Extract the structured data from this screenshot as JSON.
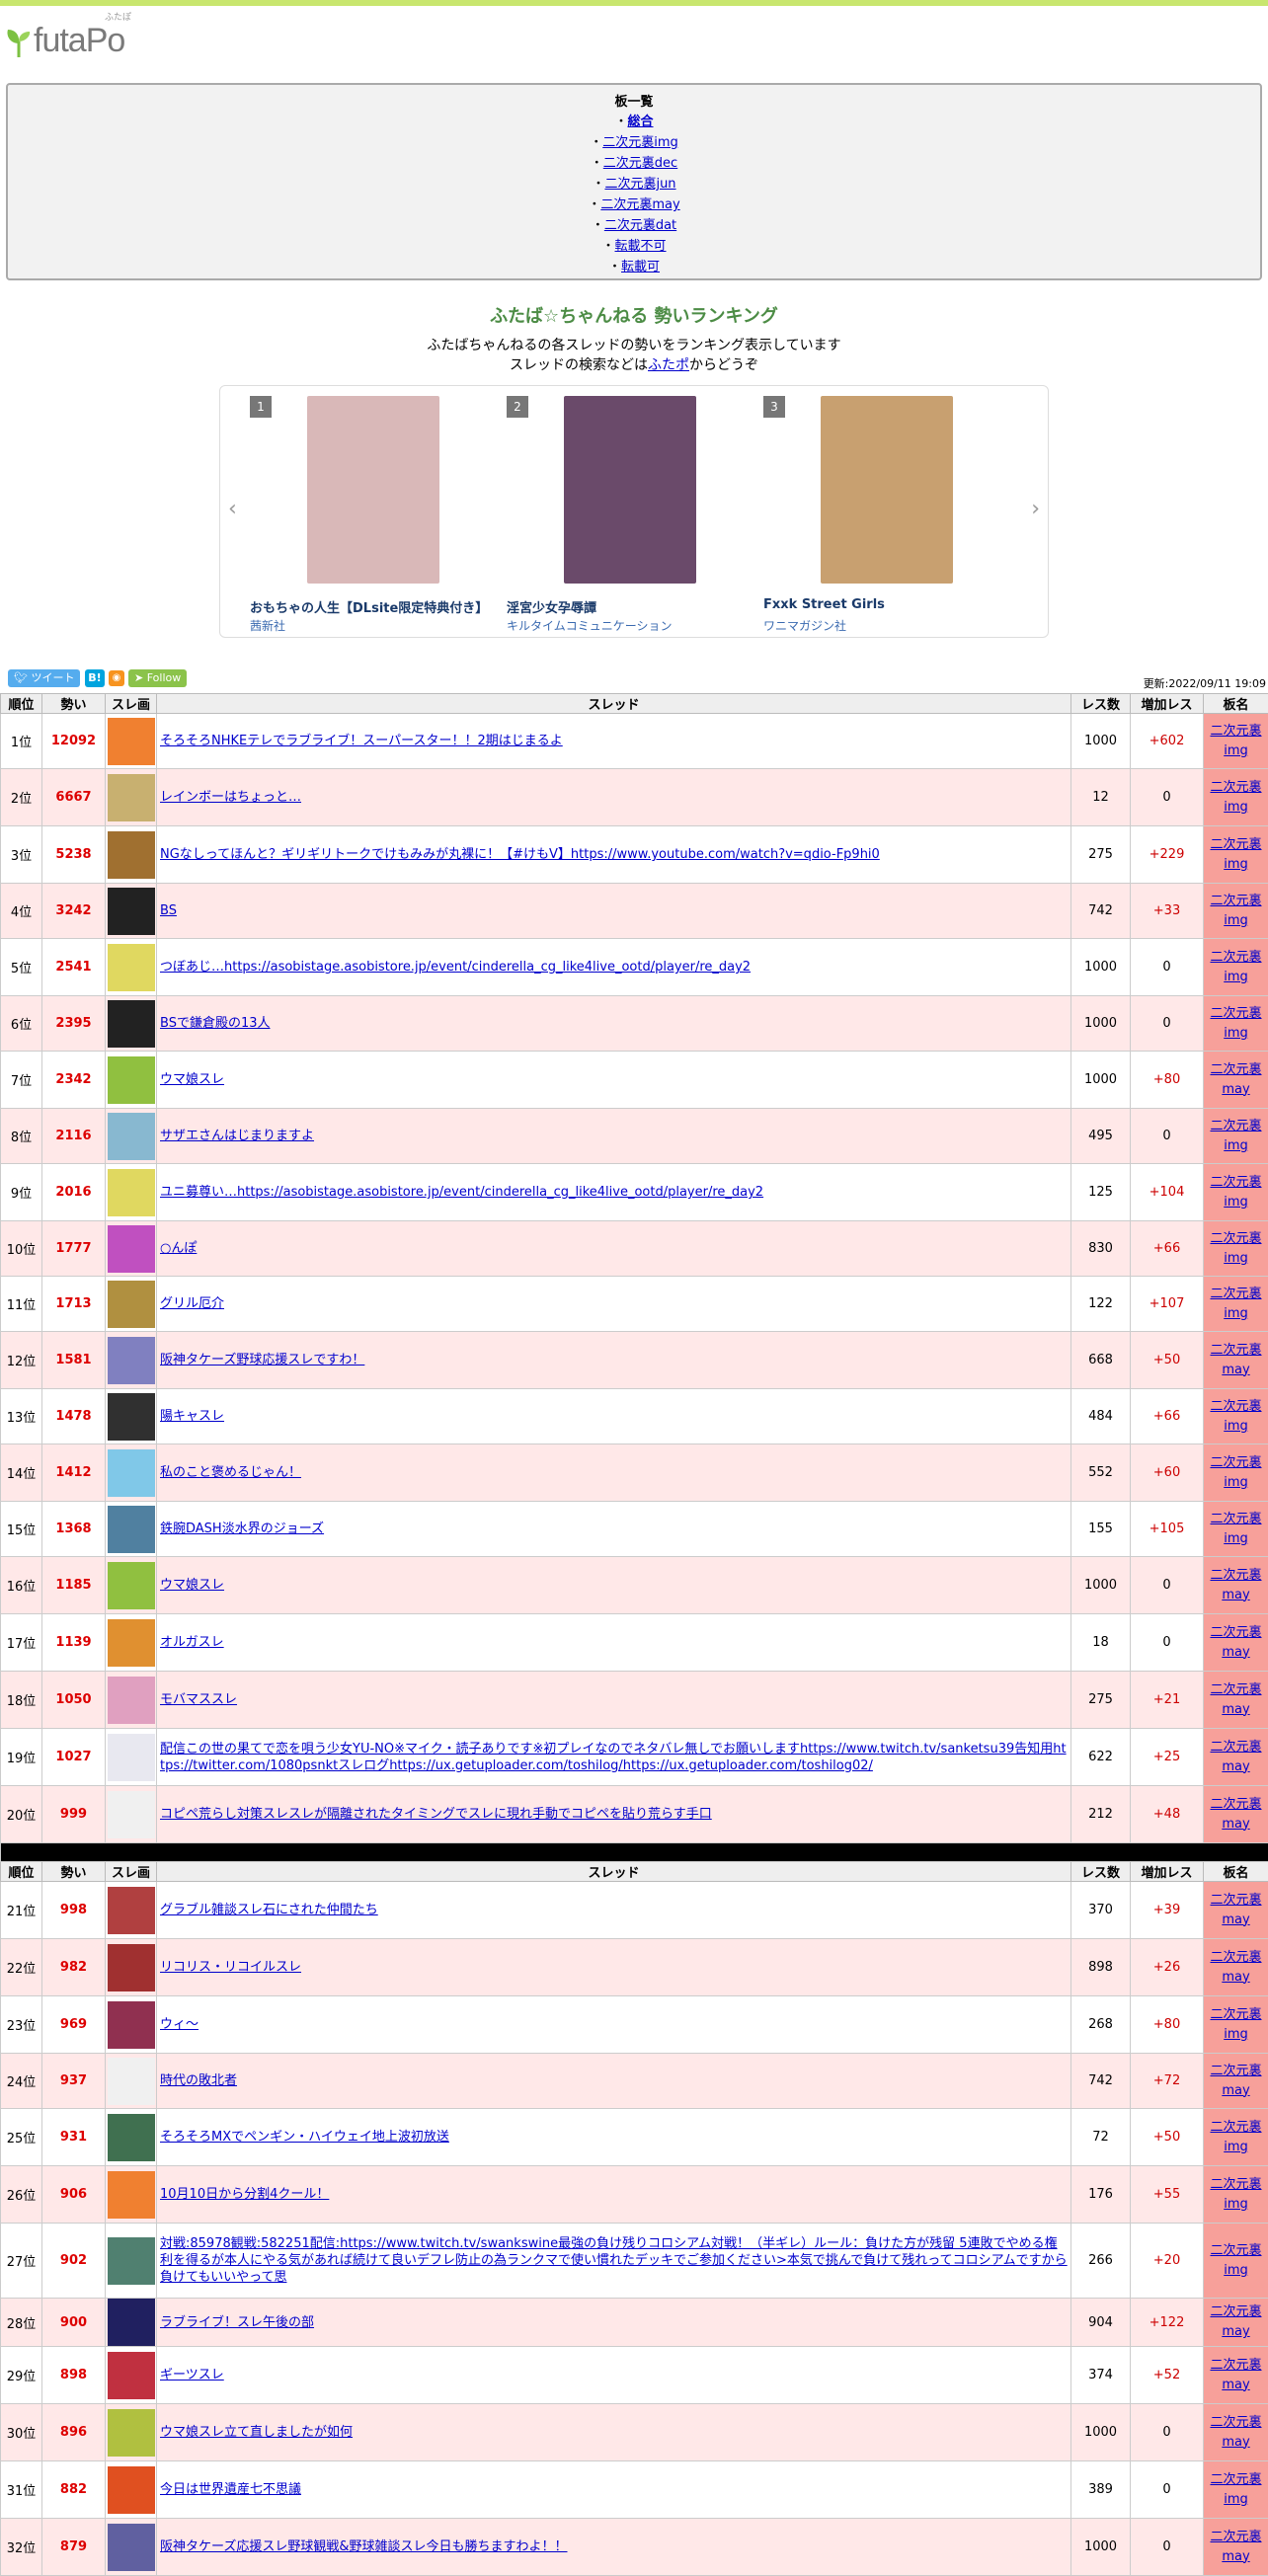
{
  "site": {
    "logo": "futaPo",
    "logo_ruby": "ふたぽ"
  },
  "boards": {
    "title": "板一覧",
    "items": [
      "総合",
      "二次元裏img",
      "二次元裏dec",
      "二次元裏jun",
      "二次元裏may",
      "二次元裏dat",
      "転載不可",
      "転載可"
    ]
  },
  "ranking": {
    "title": "ふたば☆ちゃんねる 勢いランキング",
    "desc1": "ふたばちゃんねるの各スレッドの勢いをランキング表示しています",
    "desc2_pre": "スレッドの検索などは",
    "desc2_link": "ふたポ",
    "desc2_post": "からどうぞ"
  },
  "carousel": [
    {
      "rank": "1",
      "title": "おもちゃの人生【DLsite限定特典付き】",
      "publisher": "茜新社",
      "color": "#d9b8b8"
    },
    {
      "rank": "2",
      "title": "淫宮少女孕辱譚",
      "publisher": "キルタイムコミュニケーション",
      "color": "#6a4a6a"
    },
    {
      "rank": "3",
      "title": "Fxxk Street Girls",
      "publisher": "ワニマガジン社",
      "color": "#c8a070"
    }
  ],
  "social": {
    "tweet": "ツイート",
    "hatena": "B!",
    "rss": "",
    "follow": "Follow"
  },
  "updated": "更新:2022/09/11 19:09",
  "columns": [
    "順位",
    "勢い",
    "スレ画",
    "スレッド",
    "レス数",
    "増加レス",
    "板名"
  ],
  "threads": [
    {
      "rank": "1位",
      "ikioi": "12092",
      "title": "そろそろNHKEテレでラブライブ！スーパースター！！2期はじまるよ",
      "res": "1000",
      "inc": "+602",
      "board1": "二次元裏",
      "board2": "img",
      "color": "#f08030"
    },
    {
      "rank": "2位",
      "ikioi": "6667",
      "title": "レインボーはちょっと…",
      "res": "12",
      "inc": "0",
      "board1": "二次元裏",
      "board2": "img",
      "color": "#c8b070"
    },
    {
      "rank": "3位",
      "ikioi": "5238",
      "title": "NGなしってほんと？ギリギリトークでけもみみが丸裸に！【#けもV】https://www.youtube.com/watch?v=qdio-Fp9hi0",
      "res": "275",
      "inc": "+229",
      "board1": "二次元裏",
      "board2": "img",
      "color": "#a07030"
    },
    {
      "rank": "4位",
      "ikioi": "3242",
      "title": "BS",
      "res": "742",
      "inc": "+33",
      "board1": "二次元裏",
      "board2": "img",
      "color": "#222222"
    },
    {
      "rank": "5位",
      "ikioi": "2541",
      "title": "つぼあじ…https://asobistage.asobistore.jp/event/cinderella_cg_like4live_ootd/player/re_day2",
      "res": "1000",
      "inc": "0",
      "board1": "二次元裏",
      "board2": "img",
      "color": "#e0d860"
    },
    {
      "rank": "6位",
      "ikioi": "2395",
      "title": "BSで鎌倉殿の13人",
      "res": "1000",
      "inc": "0",
      "board1": "二次元裏",
      "board2": "img",
      "color": "#222222"
    },
    {
      "rank": "7位",
      "ikioi": "2342",
      "title": "ウマ娘スレ",
      "res": "1000",
      "inc": "+80",
      "board1": "二次元裏",
      "board2": "may",
      "color": "#90c040"
    },
    {
      "rank": "8位",
      "ikioi": "2116",
      "title": "サザエさんはじまりますよ",
      "res": "495",
      "inc": "0",
      "board1": "二次元裏",
      "board2": "img",
      "color": "#88b8d0"
    },
    {
      "rank": "9位",
      "ikioi": "2016",
      "title": "ユニ募尊い…https://asobistage.asobistore.jp/event/cinderella_cg_like4live_ootd/player/re_day2",
      "res": "125",
      "inc": "+104",
      "board1": "二次元裏",
      "board2": "img",
      "color": "#e0d860"
    },
    {
      "rank": "10位",
      "ikioi": "1777",
      "title": "○んぽ",
      "res": "830",
      "inc": "+66",
      "board1": "二次元裏",
      "board2": "img",
      "color": "#c050c0"
    },
    {
      "rank": "11位",
      "ikioi": "1713",
      "title": "グリル厄介",
      "res": "122",
      "inc": "+107",
      "board1": "二次元裏",
      "board2": "img",
      "color": "#b09040"
    },
    {
      "rank": "12位",
      "ikioi": "1581",
      "title": "阪神タケーズ野球応援スレですわ！",
      "res": "668",
      "inc": "+50",
      "board1": "二次元裏",
      "board2": "may",
      "color": "#8080c0"
    },
    {
      "rank": "13位",
      "ikioi": "1478",
      "title": "陽キャスレ",
      "res": "484",
      "inc": "+66",
      "board1": "二次元裏",
      "board2": "img",
      "color": "#303030"
    },
    {
      "rank": "14位",
      "ikioi": "1412",
      "title": "私のこと褒めるじゃん！",
      "res": "552",
      "inc": "+60",
      "board1": "二次元裏",
      "board2": "img",
      "color": "#80c8e8"
    },
    {
      "rank": "15位",
      "ikioi": "1368",
      "title": "鉄腕DASH淡水界のジョーズ",
      "res": "155",
      "inc": "+105",
      "board1": "二次元裏",
      "board2": "img",
      "color": "#5080a0"
    },
    {
      "rank": "16位",
      "ikioi": "1185",
      "title": "ウマ娘スレ",
      "res": "1000",
      "inc": "0",
      "board1": "二次元裏",
      "board2": "may",
      "color": "#90c040"
    },
    {
      "rank": "17位",
      "ikioi": "1139",
      "title": "オルガスレ",
      "res": "18",
      "inc": "0",
      "board1": "二次元裏",
      "board2": "may",
      "color": "#e09030"
    },
    {
      "rank": "18位",
      "ikioi": "1050",
      "title": "モバマススレ",
      "res": "275",
      "inc": "+21",
      "board1": "二次元裏",
      "board2": "may",
      "color": "#e0a0c0"
    },
    {
      "rank": "19位",
      "ikioi": "1027",
      "title": "配信この世の果てで恋を唄う少女YU-NO※マイク・読子ありです※初プレイなのでネタバレ無しでお願いしますhttps://www.twitch.tv/sanketsu39告知用https://twitter.com/1080psnktスレログhttps://ux.getuploader.com/toshilog/https://ux.getuploader.com/toshilog02/",
      "res": "622",
      "inc": "+25",
      "board1": "二次元裏",
      "board2": "may",
      "color": "#e8e8f0"
    },
    {
      "rank": "20位",
      "ikioi": "999",
      "title": "コピペ荒らし対策スレスレが隔離されたタイミングでスレに現れ手動でコピペを貼り荒らす手口",
      "res": "212",
      "inc": "+48",
      "board1": "二次元裏",
      "board2": "may",
      "color": "#f0f0f0"
    },
    {
      "rank": "21位",
      "ikioi": "998",
      "title": "グラブル雑談スレ石にされた仲間たち",
      "res": "370",
      "inc": "+39",
      "board1": "二次元裏",
      "board2": "may",
      "color": "#b04040"
    },
    {
      "rank": "22位",
      "ikioi": "982",
      "title": "リコリス・リコイルスレ",
      "res": "898",
      "inc": "+26",
      "board1": "二次元裏",
      "board2": "may",
      "color": "#a03030"
    },
    {
      "rank": "23位",
      "ikioi": "969",
      "title": "ウィ〜",
      "res": "268",
      "inc": "+80",
      "board1": "二次元裏",
      "board2": "img",
      "color": "#903050"
    },
    {
      "rank": "24位",
      "ikioi": "937",
      "title": "時代の敗北者",
      "res": "742",
      "inc": "+72",
      "board1": "二次元裏",
      "board2": "may",
      "color": "#f0f0f0"
    },
    {
      "rank": "25位",
      "ikioi": "931",
      "title": "そろそろMXでペンギン・ハイウェイ地上波初放送",
      "res": "72",
      "inc": "+50",
      "board1": "二次元裏",
      "board2": "img",
      "color": "#407050"
    },
    {
      "rank": "26位",
      "ikioi": "906",
      "title": "10月10日から分割4クール！",
      "res": "176",
      "inc": "+55",
      "board1": "二次元裏",
      "board2": "img",
      "color": "#f08030"
    },
    {
      "rank": "27位",
      "ikioi": "902",
      "title": "対戦:85978観戦:582251配信:https://www.twitch.tv/swankswine最強の負け残りコロシアム対戦！（半ギレ）ルール：負けた方が残留 5連敗でやめる権利を得るが本人にやる気があれば続けて良いデフレ防止の為ランクマで使い慣れたデッキでご参加ください>本気で挑んで負けて残れってコロシアムですから負けてもいいやって思",
      "res": "266",
      "inc": "+20",
      "board1": "二次元裏",
      "board2": "img",
      "color": "#508070"
    },
    {
      "rank": "28位",
      "ikioi": "900",
      "title": "ラブライブ！スレ午後の部",
      "res": "904",
      "inc": "+122",
      "board1": "二次元裏",
      "board2": "may",
      "color": "#202060"
    },
    {
      "rank": "29位",
      "ikioi": "898",
      "title": "ギーツスレ",
      "res": "374",
      "inc": "+52",
      "board1": "二次元裏",
      "board2": "may",
      "color": "#c03040"
    },
    {
      "rank": "30位",
      "ikioi": "896",
      "title": "ウマ娘スレ立て直しましたが如何",
      "res": "1000",
      "inc": "0",
      "board1": "二次元裏",
      "board2": "may",
      "color": "#b0c040"
    },
    {
      "rank": "31位",
      "ikioi": "882",
      "title": "今日は世界遺産七不思議",
      "res": "389",
      "inc": "0",
      "board1": "二次元裏",
      "board2": "img",
      "color": "#e05020"
    },
    {
      "rank": "32位",
      "ikioi": "879",
      "title": "阪神タケーズ応援スレ野球観戦&野球雑談スレ今日も勝ちますわよ！！",
      "res": "1000",
      "inc": "0",
      "board1": "二次元裏",
      "board2": "may",
      "color": "#6060a0"
    }
  ]
}
